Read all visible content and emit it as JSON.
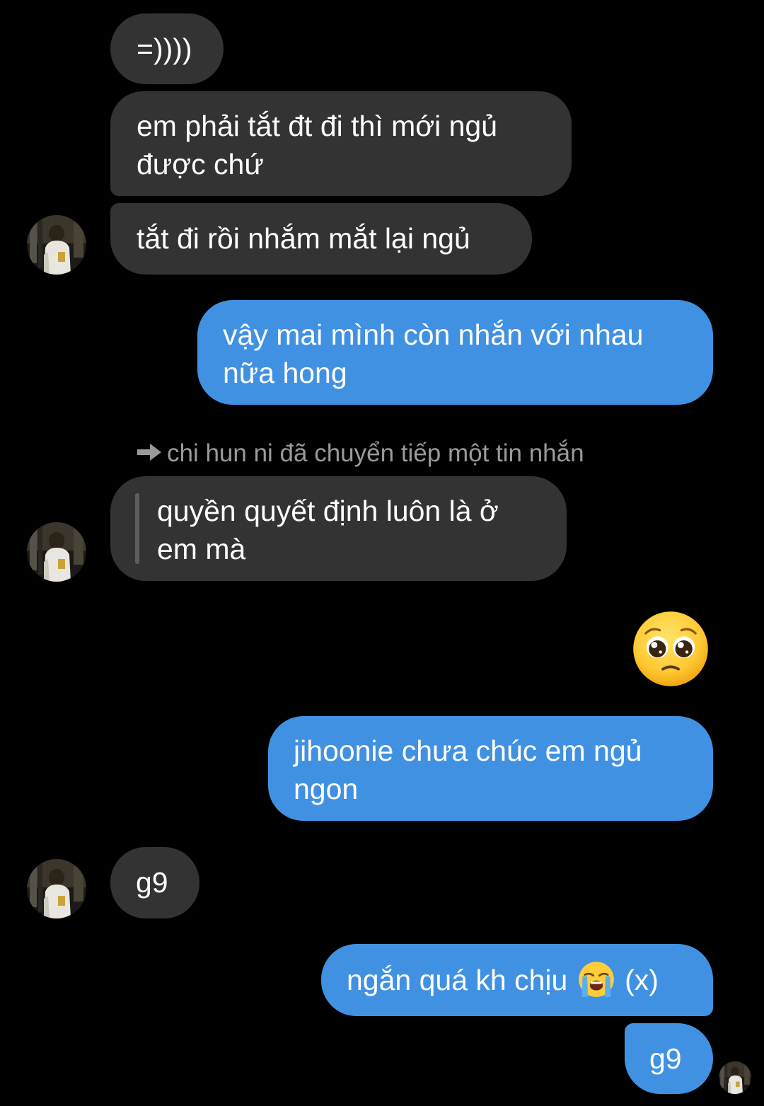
{
  "messages": [
    {
      "id": "m1",
      "from": "them",
      "text": "=))))"
    },
    {
      "id": "m2",
      "from": "them",
      "lines": [
        "em phải tắt đt đi thì mới ngủ",
        "được chứ"
      ]
    },
    {
      "id": "m3",
      "from": "them",
      "text": "tắt đi rồi nhắm mắt lại ngủ"
    },
    {
      "id": "m4",
      "from": "me",
      "lines": [
        "vậy mai mình còn nhắn với nhau",
        "nữa hong"
      ]
    },
    {
      "id": "m5",
      "from": "them",
      "forwarded_note": "chi hun ni đã chuyển tiếp một tin nhắn",
      "lines": [
        "quyền quyết định luôn là ở",
        "em mà"
      ]
    },
    {
      "id": "m6",
      "from": "me",
      "emoji": "pleading-face"
    },
    {
      "id": "m7",
      "from": "me",
      "lines": [
        "jihoonie chưa chúc em ngủ",
        "ngon"
      ]
    },
    {
      "id": "m8",
      "from": "them",
      "text": "g9"
    },
    {
      "id": "m9",
      "from": "me",
      "text_before": "ngắn quá kh chịu",
      "emoji": "loudly-crying-face",
      "text_after": "(x)"
    },
    {
      "id": "m10",
      "from": "me",
      "text": "g9"
    }
  ],
  "icons": {
    "forward": "forward-arrow-icon",
    "avatar": "contact-avatar",
    "seen": "seen-avatar"
  },
  "colors": {
    "background": "#000000",
    "incoming_bubble": "#333333",
    "outgoing_bubble": "#4191e3",
    "meta_text": "#9a9a9a"
  }
}
